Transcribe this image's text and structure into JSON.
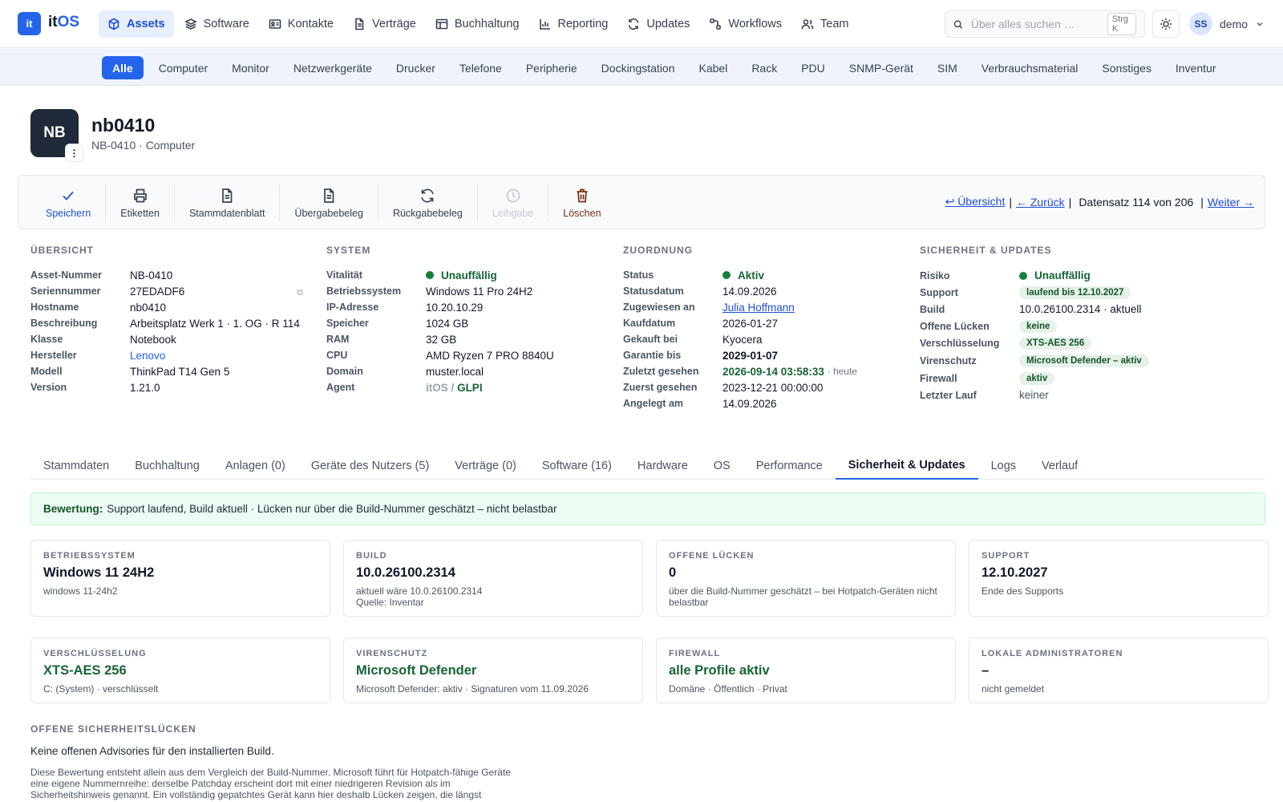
{
  "brand": {
    "logo": "it",
    "name_prefix": "it",
    "name_suffix": "OS"
  },
  "nav": {
    "items": [
      {
        "label": "Assets",
        "icon": "cube-icon",
        "active": true
      },
      {
        "label": "Software",
        "icon": "layers-icon"
      },
      {
        "label": "Kontakte",
        "icon": "contact-card-icon"
      },
      {
        "label": "Verträge",
        "icon": "document-icon"
      },
      {
        "label": "Buchhaltung",
        "icon": "table-icon"
      },
      {
        "label": "Reporting",
        "icon": "bar-chart-icon"
      },
      {
        "label": "Updates",
        "icon": "refresh-icon"
      },
      {
        "label": "Workflows",
        "icon": "workflow-icon"
      },
      {
        "label": "Team",
        "icon": "users-icon"
      }
    ],
    "search_placeholder": "Über alles suchen …",
    "search_shortcut": "Strg K",
    "user_initials": "SS",
    "user_name": "demo"
  },
  "subnav": {
    "items": [
      "Alle",
      "Computer",
      "Monitor",
      "Netzwerkgeräte",
      "Drucker",
      "Telefone",
      "Peripherie",
      "Dockingstation",
      "Kabel",
      "Rack",
      "PDU",
      "SNMP-Gerät",
      "SIM",
      "Verbrauchsmaterial",
      "Sonstiges",
      "Inventur"
    ],
    "active": "Alle"
  },
  "asset": {
    "initials": "NB",
    "name": "nb0410",
    "subtitle": "NB-0410 · Computer",
    "menu_glyph": "⋮"
  },
  "toolbar": {
    "buttons": [
      {
        "label": "Speichern",
        "icon": "check-icon",
        "state": "primary"
      },
      {
        "label": "Etiketten",
        "icon": "printer-icon"
      },
      {
        "label": "Stammdatenblatt",
        "icon": "document-icon"
      },
      {
        "label": "Übergabebeleg",
        "icon": "document-icon"
      },
      {
        "label": "Rückgabebeleg",
        "icon": "refresh-icon"
      },
      {
        "label": "Leihgabe",
        "icon": "clock-icon",
        "state": "disabled"
      },
      {
        "label": "Löschen",
        "icon": "trash-icon",
        "state": "danger"
      }
    ],
    "overview_link": "↩ Übersicht",
    "back_link": "← Zurück",
    "record_info": "Datensatz 114 von 206",
    "next_link": "Weiter →",
    "separator": "|"
  },
  "overview": {
    "heading": "ÜBERSICHT",
    "rows": [
      {
        "k": "Asset-Nummer",
        "v": "NB-0410"
      },
      {
        "k": "Seriennummer",
        "v": "27EDADF6",
        "copy": "⧉"
      },
      {
        "k": "Hostname",
        "v": "nb0410"
      },
      {
        "k": "Beschreibung",
        "v": "Arbeitsplatz Werk 1 · 1. OG · R 114"
      },
      {
        "k": "Klasse",
        "v": "Notebook"
      },
      {
        "k": "Hersteller",
        "v": "Lenovo",
        "link": true
      },
      {
        "k": "Modell",
        "v": "ThinkPad T14 Gen 5"
      },
      {
        "k": "Version",
        "v": "1.21.0"
      }
    ]
  },
  "system": {
    "heading": "SYSTEM",
    "vitality_label": "Vitalität",
    "vitality": "Unauffällig",
    "rows": [
      {
        "k": "Betriebssystem",
        "v": "Windows 11 Pro 24H2"
      },
      {
        "k": "IP-Adresse",
        "v": "10.20.10.29"
      },
      {
        "k": "Speicher",
        "v": "1024 GB"
      },
      {
        "k": "RAM",
        "v": "32 GB"
      },
      {
        "k": "CPU",
        "v": "AMD Ryzen 7 PRO 8840U"
      },
      {
        "k": "Domain",
        "v": "muster.local"
      }
    ],
    "agent_label": "Agent",
    "agent_itos": "itOS",
    "agent_sep": "/",
    "agent_glpi": "GLPI"
  },
  "assignment": {
    "heading": "ZUORDNUNG",
    "status_label": "Status",
    "status": "Aktiv",
    "status_date_label": "Statusdatum",
    "status_date": "14.09.2026",
    "assigned_label": "Zugewiesen an",
    "assigned": "Julia Hoffmann",
    "purchase_label": "Kaufdatum",
    "purchase": "2026-01-27",
    "vendor_label": "Gekauft bei",
    "vendor": "Kyocera",
    "warranty_label": "Garantie bis",
    "warranty": "2029-01-07",
    "last_seen_label": "Zuletzt gesehen",
    "last_seen": "2026-09-14 03:58:33",
    "last_seen_note": "· heute",
    "first_seen_label": "Zuerst gesehen",
    "first_seen": "2023-12-21 00:00:00",
    "created_label": "Angelegt am",
    "created": "14.09.2026"
  },
  "security": {
    "heading": "SICHERHEIT & UPDATES",
    "risk_label": "Risiko",
    "risk": "Unauffällig",
    "support_label": "Support",
    "support": "laufend bis 12.10.2027",
    "build_label": "Build",
    "build": "10.0.26100.2314 · aktuell",
    "gaps_label": "Offene Lücken",
    "gaps": "keine",
    "encryption_label": "Verschlüsselung",
    "encryption": "XTS-AES 256",
    "antivirus_label": "Virenschutz",
    "antivirus": "Microsoft Defender – aktiv",
    "firewall_label": "Firewall",
    "firewall": "aktiv",
    "last_run_label": "Letzter Lauf",
    "last_run": "keiner"
  },
  "tabs": {
    "items": [
      "Stammdaten",
      "Buchhaltung",
      "Anlagen (0)",
      "Geräte des Nutzers (5)",
      "Verträge (0)",
      "Software (16)",
      "Hardware",
      "OS",
      "Performance",
      "Sicherheit & Updates",
      "Logs",
      "Verlauf"
    ],
    "active": "Sicherheit & Updates"
  },
  "banner": {
    "label": "Bewertung:",
    "text": "Support laufend, Build aktuell · Lücken nur über die Build-Nummer geschätzt – nicht belastbar"
  },
  "cards": [
    {
      "label": "BETRIEBSSYSTEM",
      "value": "Windows 11 24H2",
      "sub": [
        "windows 11-24h2"
      ]
    },
    {
      "label": "BUILD",
      "value": "10.0.26100.2314",
      "sub": [
        "aktuell wäre 10.0.26100.2314",
        "Quelle: Inventar"
      ]
    },
    {
      "label": "OFFENE LÜCKEN",
      "value": "0",
      "sub": [
        "über die Build-Nummer geschätzt – bei Hotpatch-Geräten nicht belastbar"
      ]
    },
    {
      "label": "SUPPORT",
      "value": "12.10.2027",
      "sub": [
        "Ende des Supports"
      ]
    },
    {
      "label": "VERSCHLÜSSELUNG",
      "value": "XTS-AES 256",
      "sub": [
        "C: (System) · verschlüsselt"
      ],
      "green": true
    },
    {
      "label": "VIRENSCHUTZ",
      "value": "Microsoft Defender",
      "sub": [
        "Microsoft Defender: aktiv · Signaturen vom 11.09.2026"
      ],
      "green": true
    },
    {
      "label": "FIREWALL",
      "value": "alle Profile aktiv",
      "sub": [
        "Domäne · Öffentlich · Privat"
      ],
      "green": true
    },
    {
      "label": "LOKALE ADMINISTRATOREN",
      "value": "–",
      "sub": [
        "nicht gemeldet"
      ]
    }
  ],
  "vulns": {
    "heading": "OFFENE SICHERHEITSLÜCKEN",
    "none": "Keine offenen Advisories für den installierten Build.",
    "note": "Diese Bewertung entsteht allein aus dem Vergleich der Build-Nummer. Microsoft führt für Hotpatch-fähige Geräte eine eigene Nummernreihe: derselbe Patchday erscheint dort mit einer niedrigeren Revision als im Sicherheitshinweis genannt. Ein vollständig gepatchtes Gerät kann hier deshalb Lücken zeigen, die längst"
  }
}
